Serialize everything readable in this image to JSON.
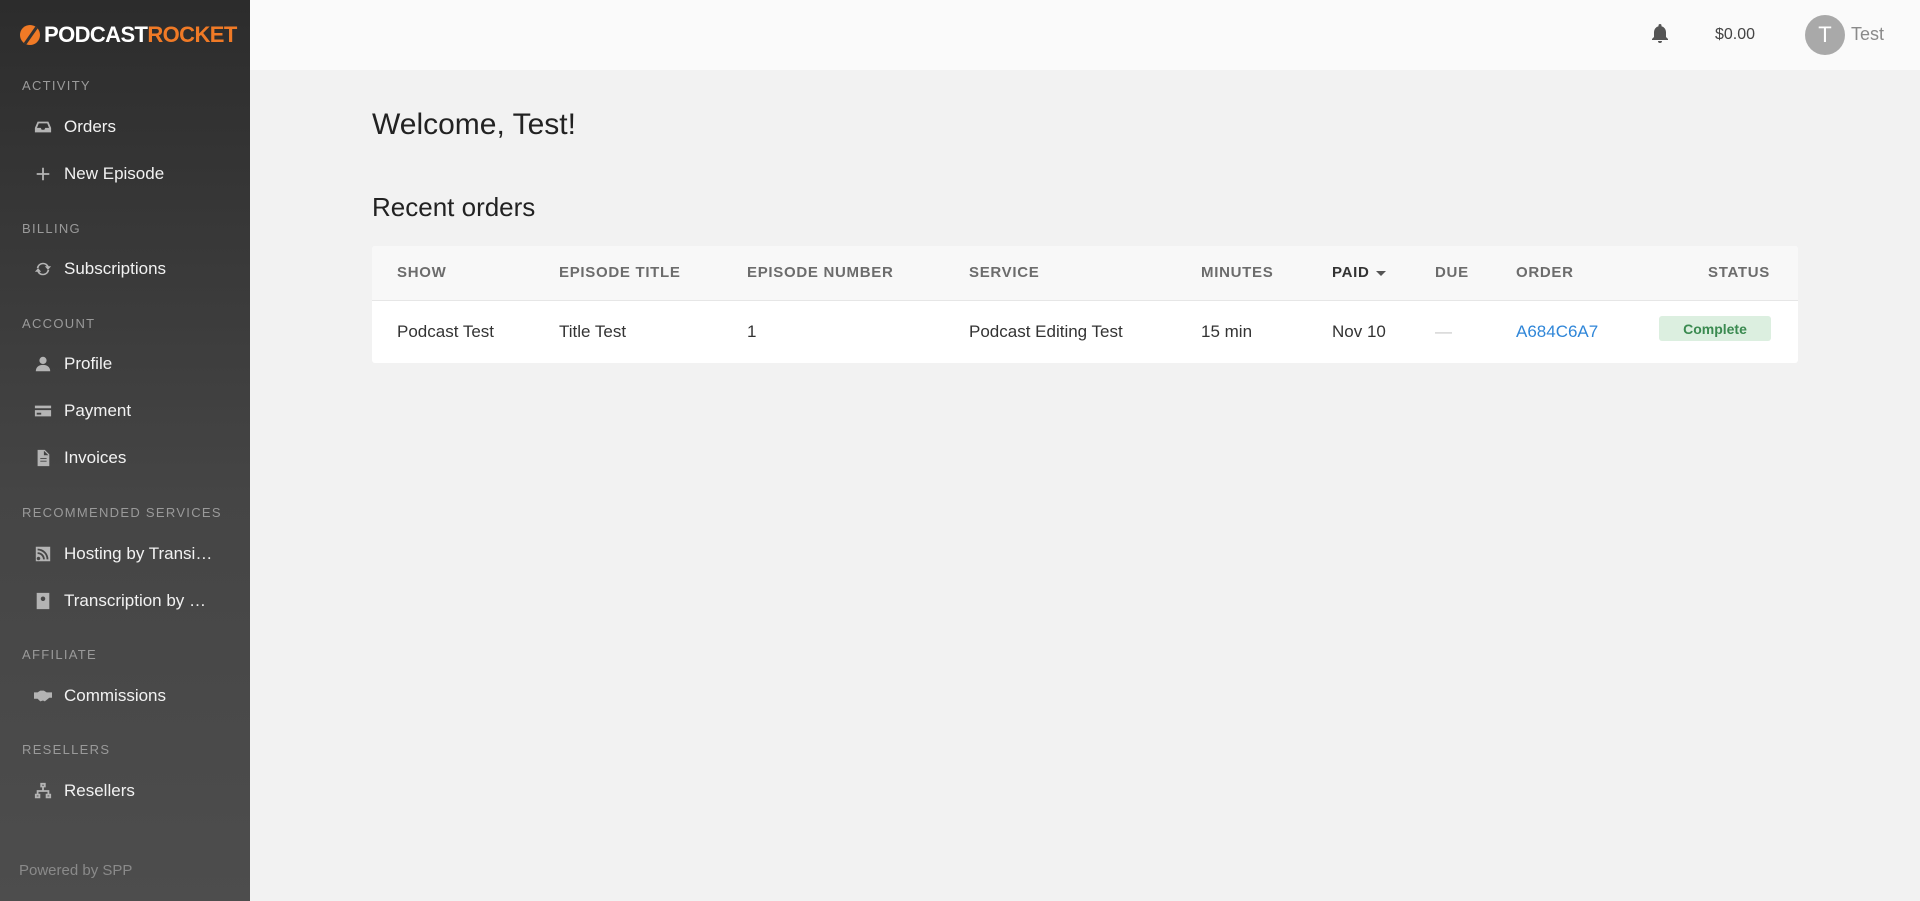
{
  "brand": {
    "logo_part1": "PODCAST",
    "logo_part2": "ROCKET",
    "accent": "#f07a26"
  },
  "sidebar": {
    "sections": [
      {
        "label": "ACTIVITY"
      },
      {
        "label": "BILLING"
      },
      {
        "label": "ACCOUNT"
      },
      {
        "label": "RECOMMENDED SERVICES"
      },
      {
        "label": "AFFILIATE"
      },
      {
        "label": "RESELLERS"
      }
    ],
    "items": [
      {
        "label": "Orders",
        "icon": "inbox-icon"
      },
      {
        "label": "New Episode",
        "icon": "plus-icon"
      },
      {
        "label": "Subscriptions",
        "icon": "refresh-icon"
      },
      {
        "label": "Profile",
        "icon": "user-icon"
      },
      {
        "label": "Payment",
        "icon": "credit-card-icon"
      },
      {
        "label": "Invoices",
        "icon": "file-icon"
      },
      {
        "label": "Hosting by Transistor",
        "icon": "rss-icon"
      },
      {
        "label": "Transcription by Rev",
        "icon": "contact-book-icon"
      },
      {
        "label": "Commissions",
        "icon": "handshake-icon"
      },
      {
        "label": "Resellers",
        "icon": "sitemap-icon"
      }
    ],
    "powered_by": "Powered by SPP"
  },
  "topbar": {
    "balance": "$0.00",
    "avatar_initial": "T",
    "username": "Test"
  },
  "main": {
    "welcome": "Welcome, Test!",
    "recent_title": "Recent orders",
    "table": {
      "columns": [
        "SHOW",
        "EPISODE TITLE",
        "EPISODE NUMBER",
        "SERVICE",
        "MINUTES",
        "PAID",
        "DUE",
        "ORDER",
        "STATUS"
      ],
      "sorted_column": "PAID",
      "rows": [
        {
          "show": "Podcast Test",
          "episode_title": "Title Test",
          "episode_number": "1",
          "service": "Podcast Editing Test",
          "minutes": "15 min",
          "paid": "Nov 10",
          "due": "—",
          "order": "A684C6A7",
          "status": "Complete"
        }
      ]
    }
  }
}
